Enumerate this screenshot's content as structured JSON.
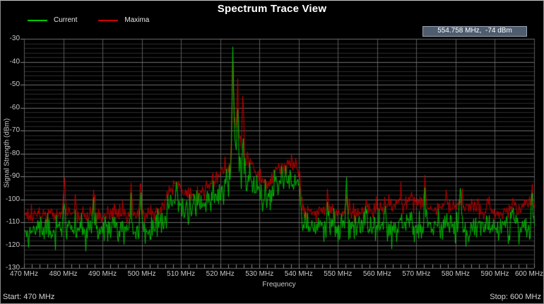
{
  "window": {
    "title": "Spectrum Trace View"
  },
  "legend": {
    "items": [
      {
        "label": "Current",
        "color": "#00c800"
      },
      {
        "label": "Maxima",
        "color": "#c80000"
      }
    ]
  },
  "readout": {
    "text": "554.758 MHz,  -74 dBm",
    "bg": "#4e5c6e",
    "border": "#96a4b4"
  },
  "footer": {
    "start": "Start: 470 MHz",
    "stop": "Stop: 600 MHz"
  },
  "chart_data": {
    "type": "line",
    "title": "Spectrum Trace View",
    "xlabel": "Frequency",
    "ylabel": "Signal Strength (dBm)",
    "x_unit": "MHz",
    "y_unit": "dBm",
    "xlim": [
      470,
      600
    ],
    "ylim": [
      -130,
      -30
    ],
    "x_tick_step": 10,
    "x_tick_labels": [
      "470 MHz",
      "480 MHz",
      "490 MHz",
      "500 MHz",
      "510 MHz",
      "520 MHz",
      "530 MHz",
      "540 MHz",
      "550 MHz",
      "560 MHz",
      "570 MHz",
      "580 MHz",
      "590 MHz",
      "600 MHz"
    ],
    "y_tick_step": 10,
    "y_tick_labels": [
      "-30",
      "-40",
      "-50",
      "-60",
      "-70",
      "-80",
      "-90",
      "-100",
      "-110",
      "-120",
      "-130"
    ],
    "background": "#000000",
    "grid": {
      "major_color": "#6e6e6e",
      "minor_color": "#2d2d2d",
      "vertical_color": "#5a5a5a",
      "tick_color": "#8a8a8a",
      "minor_step_db": 2,
      "minor_step_mhz": 2,
      "legend_position": "top-left",
      "grid_on": true
    },
    "series": [
      {
        "name": "Current",
        "key": "current",
        "color": "#00c800",
        "sigma": 3.2,
        "floor_offset": 0
      },
      {
        "name": "Maxima",
        "key": "maxima",
        "color": "#c80000",
        "sigma": 1.8,
        "floor_offset": 6
      }
    ],
    "envelope_current_dbm": [
      [
        470,
        -113
      ],
      [
        503,
        -113
      ],
      [
        505.5,
        -108
      ],
      [
        507.5,
        -101
      ],
      [
        508.8,
        -98
      ],
      [
        510.5,
        -104
      ],
      [
        513,
        -106
      ],
      [
        515.5,
        -103
      ],
      [
        518,
        -98
      ],
      [
        520.5,
        -94
      ],
      [
        522.5,
        -91
      ],
      [
        526.5,
        -90
      ],
      [
        528.5,
        -93
      ],
      [
        531,
        -100
      ],
      [
        532.5,
        -99
      ],
      [
        533.8,
        -93
      ],
      [
        536,
        -92
      ],
      [
        539.5,
        -91
      ],
      [
        540.2,
        -96
      ],
      [
        541,
        -112
      ],
      [
        600,
        -112
      ]
    ],
    "maxima_extra_dbm": [
      [
        470,
        0
      ],
      [
        557,
        0
      ],
      [
        561,
        3
      ],
      [
        571,
        4
      ],
      [
        574,
        1
      ],
      [
        576,
        3
      ],
      [
        584,
        3
      ],
      [
        587,
        0
      ],
      [
        592,
        0
      ],
      [
        595,
        2
      ],
      [
        600,
        3
      ]
    ],
    "spikes": [
      {
        "freq": 480.2,
        "current": -95,
        "maxima": -91
      },
      {
        "freq": 483.0,
        "current": -107,
        "maxima": -100
      },
      {
        "freq": 487.6,
        "current": -104,
        "maxima": -98
      },
      {
        "freq": 493.0,
        "current": -108,
        "maxima": -101
      },
      {
        "freq": 497.2,
        "current": -101,
        "maxima": -93
      },
      {
        "freq": 499.6,
        "current": -96,
        "maxima": -92
      },
      {
        "freq": 508.8,
        "current": -97,
        "maxima": -93
      },
      {
        "freq": 523.15,
        "current": -30,
        "maxima": -36,
        "hw": 0.5
      },
      {
        "freq": 523.7,
        "current": -75,
        "maxima": -62
      },
      {
        "freq": 524.35,
        "current": -58,
        "maxima": -45
      },
      {
        "freq": 524.9,
        "current": -82,
        "maxima": -68
      },
      {
        "freq": 525.7,
        "current": -76,
        "maxima": -50
      },
      {
        "freq": 536.8,
        "current": -90,
        "maxima": -85
      },
      {
        "freq": 547.3,
        "current": -104,
        "maxima": -96
      },
      {
        "freq": 552.1,
        "current": -93,
        "maxima": -97
      },
      {
        "freq": 557.2,
        "current": -107,
        "maxima": -100
      },
      {
        "freq": 562.0,
        "current": -108,
        "maxima": -100
      },
      {
        "freq": 565.9,
        "current": -105,
        "maxima": -96
      },
      {
        "freq": 568.5,
        "current": -104,
        "maxima": -97
      },
      {
        "freq": 572.1,
        "current": -98,
        "maxima": -92
      },
      {
        "freq": 577.5,
        "current": -106,
        "maxima": -98
      },
      {
        "freq": 581.1,
        "current": -95,
        "maxima": -99
      },
      {
        "freq": 588.0,
        "current": -106,
        "maxima": -99
      },
      {
        "freq": 594.5,
        "current": -103,
        "maxima": -98
      },
      {
        "freq": 599.4,
        "current": -96,
        "maxima": -93
      }
    ],
    "noise_seed": 20240501
  }
}
